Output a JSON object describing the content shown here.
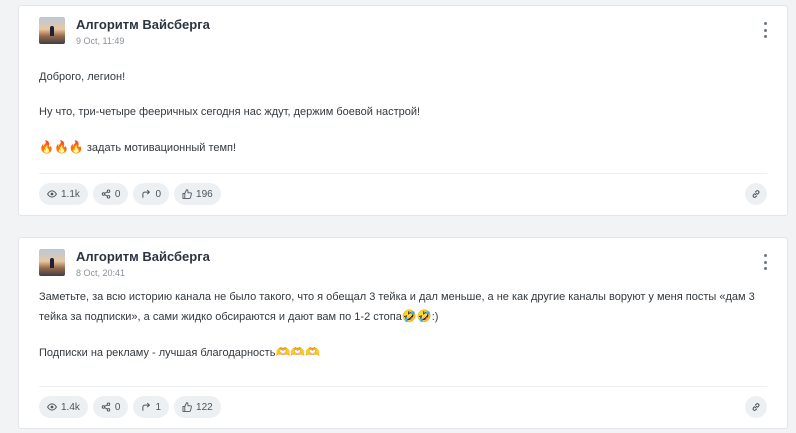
{
  "posts": [
    {
      "author": "Алгоритм Вайсберга",
      "date": "9 Oct, 11:49",
      "paragraphs": [
        "Доброго, легион!",
        "Ну что, три-четыре фееричных сегодня нас ждут, держим боевой настрой!"
      ],
      "emoji_line": {
        "emoji": "🔥🔥🔥",
        "text": " задать мотивационный темп!"
      },
      "stats": {
        "views": "1.1k",
        "shares": "0",
        "forwards": "0",
        "likes": "196"
      }
    },
    {
      "author": "Алгоритм Вайсберга",
      "date": "8 Oct, 20:41",
      "paragraphs": [
        "Заметьте, за всю историю канала не было такого, что я обещал 3 тейка и дал меньше, а не как другие каналы воруют у меня посты «дам 3 тейка за подписки», а сами жидко обсираются и дают вам по 1-2 стопа"
      ],
      "paragraph_tail": {
        "emoji": "🤣🤣",
        "text": ":)"
      },
      "emoji_line": {
        "text": "Подписки на рекламу - лучшая благодарность",
        "emoji": "🫶🫶🫶"
      },
      "stats": {
        "views": "1.4k",
        "shares": "0",
        "forwards": "1",
        "likes": "122"
      }
    }
  ],
  "icons": {
    "views": "eye-icon",
    "shares": "share-icon",
    "forwards": "forward-icon",
    "likes": "thumbs-up-icon",
    "link": "link-icon",
    "menu": "more-vertical-icon"
  }
}
